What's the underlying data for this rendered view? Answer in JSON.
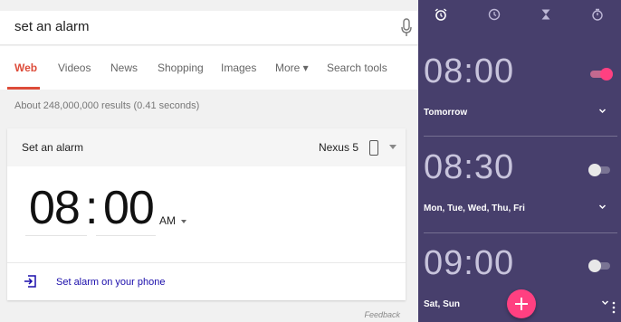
{
  "search": {
    "query": "set an alarm",
    "tabs": [
      {
        "label": "Web",
        "active": true
      },
      {
        "label": "Videos",
        "active": false
      },
      {
        "label": "News",
        "active": false
      },
      {
        "label": "Shopping",
        "active": false
      },
      {
        "label": "Images",
        "active": false
      },
      {
        "label": "More ▾",
        "active": false
      },
      {
        "label": "Search tools",
        "active": false
      }
    ],
    "results_count": "About 248,000,000 results (0.41 seconds)"
  },
  "alarm_card": {
    "title": "Set an alarm",
    "device": "Nexus 5",
    "hours": "08",
    "minutes": "00",
    "colon": ":",
    "ampm": "AM",
    "set_link": "Set alarm on your phone",
    "feedback": "Feedback"
  },
  "clock_app": {
    "tab_icons": [
      "alarm-clock-icon",
      "clock-icon",
      "hourglass-icon",
      "stopwatch-icon"
    ],
    "alarms": [
      {
        "time": "08:00",
        "days": "Tomorrow",
        "enabled": true
      },
      {
        "time": "08:30",
        "days": "Mon, Tue, Wed, Thu, Fri",
        "enabled": false
      },
      {
        "time": "09:00",
        "days": "Sat, Sun",
        "enabled": false
      }
    ],
    "fab_icon": "plus-icon"
  },
  "colors": {
    "accent_red": "#dd4b39",
    "link_blue": "#1a0dab",
    "clock_bg": "#473f6c",
    "pink_accent": "#ff4081"
  }
}
